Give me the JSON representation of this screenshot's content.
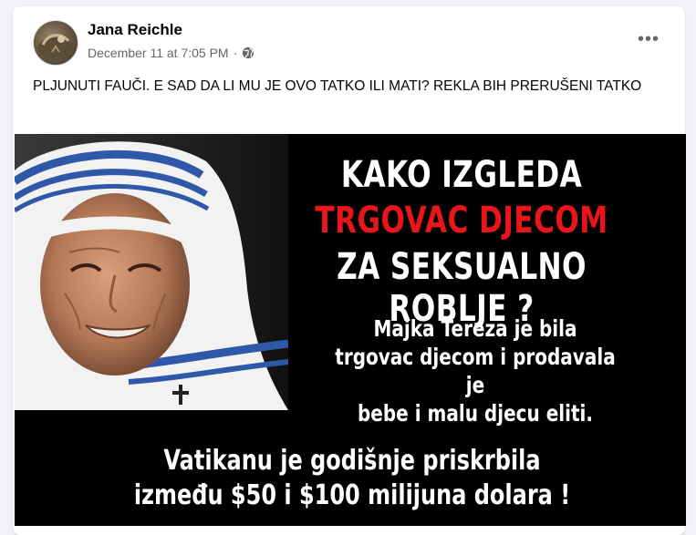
{
  "post": {
    "author": "Jana Reichle",
    "timestamp": "December 11 at 7:05 PM",
    "separator": "·",
    "privacy_icon": "globe-icon",
    "more_icon": "more-options-icon",
    "more_label": "•••",
    "text": "PLJUNUTI FAUČI. E SAD DA LI MU JE OVO TATKO ILI MATI? REKLA BIH PRERUŠENI TATKO"
  },
  "image": {
    "headline_line1": "KAKO IZGLEDA",
    "headline_line2": "TRGOVAC DJECOM",
    "headline_line3": "ZA SEKSUALNO ROBLJE ?",
    "body_line1": "Majka Tereza je bila",
    "body_line2": "trgovac djecom i prodavala je",
    "body_line3": "bebe i malu djecu eliti.",
    "footer_line1": "Vatikanu je godišnje priskrbila",
    "footer_line2": "između $50 i $100 milijuna dolara !",
    "colors": {
      "background": "#000000",
      "highlight": "#e8151b",
      "text": "#ffffff"
    }
  }
}
